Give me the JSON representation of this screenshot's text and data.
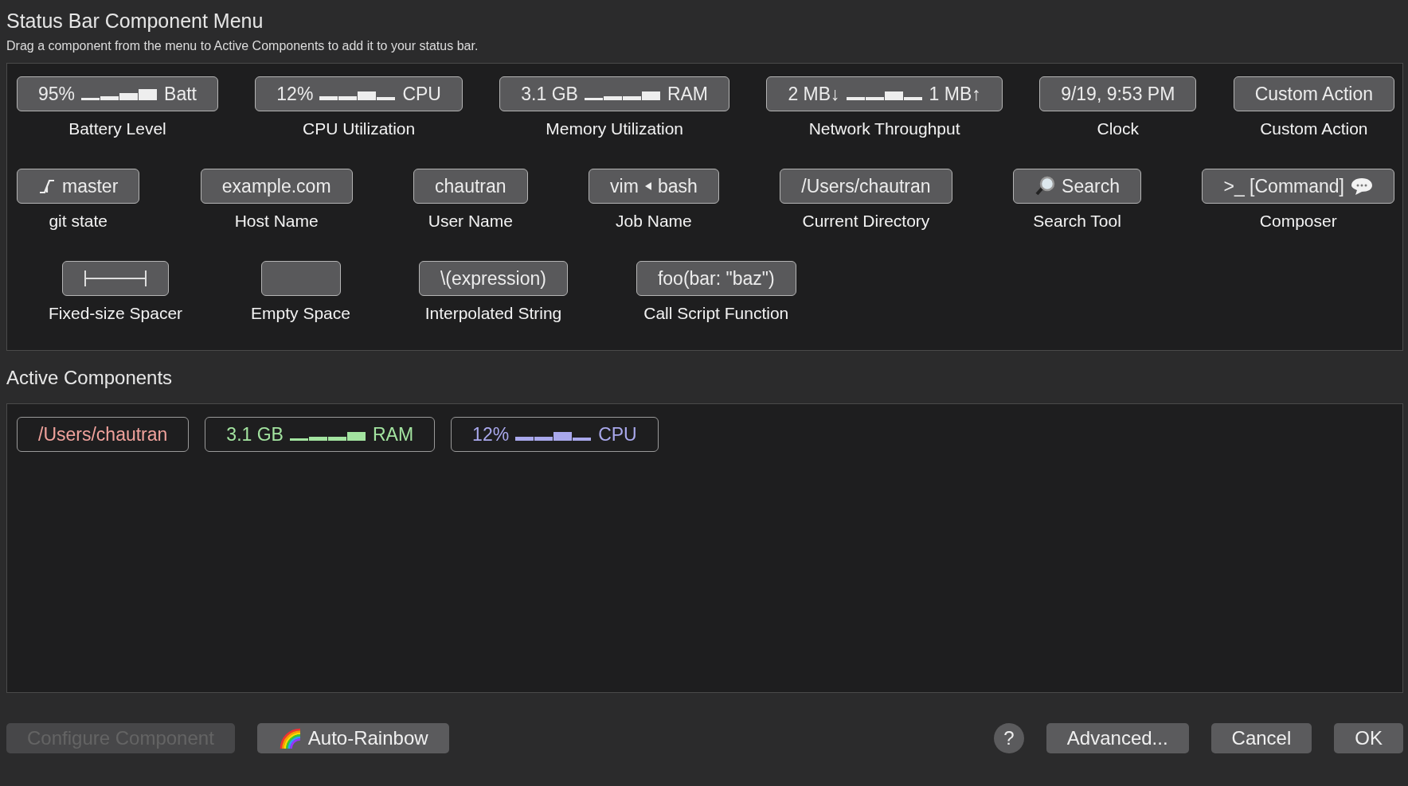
{
  "header": {
    "title": "Status Bar Component Menu",
    "subtitle": "Drag a component from the menu to Active Components to add it to your status bar."
  },
  "menu": {
    "components": [
      {
        "kind": "battery",
        "before": "95%",
        "after": "Batt",
        "label": "Battery Level"
      },
      {
        "kind": "cpu",
        "before": "12%",
        "after": "CPU",
        "label": "CPU Utilization"
      },
      {
        "kind": "memory",
        "before": "3.1 GB",
        "after": "RAM",
        "label": "Memory Utilization"
      },
      {
        "kind": "network",
        "before": "2 MB↓",
        "after": "1 MB↑",
        "label": "Network Throughput"
      },
      {
        "kind": "text",
        "text": "9/19, 9:53 PM",
        "label": "Clock"
      },
      {
        "kind": "text",
        "text": "Custom Action",
        "label": "Custom Action"
      },
      {
        "kind": "git",
        "text": "master",
        "label": "git state"
      },
      {
        "kind": "text",
        "text": "example.com",
        "label": "Host Name"
      },
      {
        "kind": "text",
        "text": "chautran",
        "label": "User Name"
      },
      {
        "kind": "job",
        "before": "vim",
        "after": "bash",
        "label": "Job Name"
      },
      {
        "kind": "text",
        "text": "/Users/chautran",
        "label": "Current Directory"
      },
      {
        "kind": "search",
        "text": "Search",
        "label": "Search Tool"
      },
      {
        "kind": "composer",
        "text": ">_ [Command]",
        "label": "Composer"
      },
      {
        "kind": "spacer",
        "label": "Fixed-size Spacer"
      },
      {
        "kind": "empty",
        "label": "Empty Space"
      },
      {
        "kind": "text",
        "text": "\\(expression)",
        "label": "Interpolated String"
      },
      {
        "kind": "text",
        "text": "foo(bar: \"baz\")",
        "label": "Call Script Function"
      }
    ]
  },
  "active": {
    "title": "Active Components",
    "items": [
      {
        "kind": "text",
        "text": "/Users/chautran",
        "color": "#f0a29c"
      },
      {
        "kind": "memory",
        "before": "3.1 GB",
        "after": "RAM",
        "color": "#a3e4a0"
      },
      {
        "kind": "cpu",
        "before": "12%",
        "after": "CPU",
        "color": "#a9a8ec"
      }
    ]
  },
  "footer": {
    "configure": {
      "label": "Configure Component",
      "disabled": true
    },
    "rainbow": "Auto-Rainbow",
    "help": "?",
    "buttons": [
      "Advanced...",
      "Cancel",
      "OK"
    ]
  }
}
